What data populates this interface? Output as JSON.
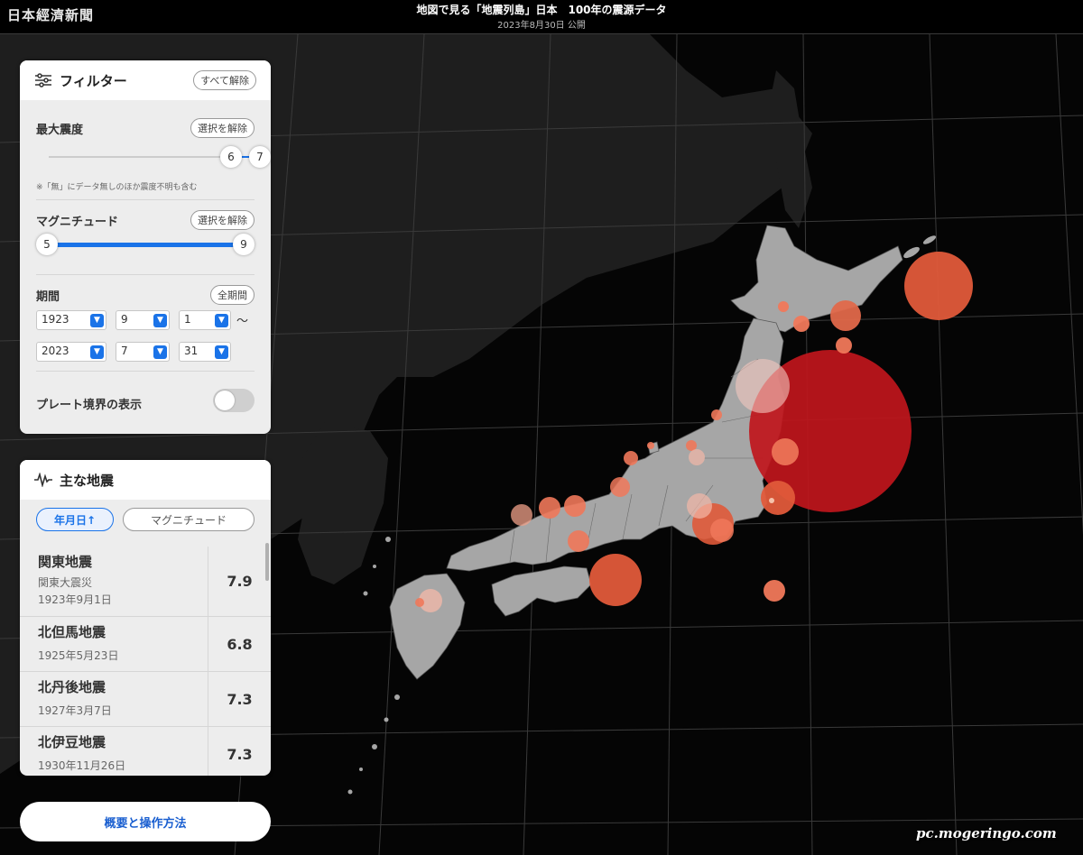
{
  "header": {
    "logo": "日本經濟新聞",
    "headline": "地図で見る「地震列島」日本　100年の震源データ",
    "date": "2023年8月30日 公開"
  },
  "filter": {
    "title": "フィルター",
    "clear_all": "すべて解除",
    "intensity": {
      "label": "最大震度",
      "clear": "選択を解除",
      "low": "6",
      "high": "7",
      "note": "※「無」にデータ無しのほか震度不明も含む"
    },
    "magnitude": {
      "label": "マグニチュード",
      "clear": "選択を解除",
      "low": "5",
      "high": "9"
    },
    "period": {
      "label": "期間",
      "all": "全期間",
      "from": {
        "year": "1923",
        "month": "9",
        "day": "1"
      },
      "tilde": "〜",
      "to": {
        "year": "2023",
        "month": "7",
        "day": "31"
      }
    },
    "plate": {
      "label": "プレート境界の表示",
      "enabled": false
    }
  },
  "quakes": {
    "title": "主な地震",
    "sort_date": "年月日↑",
    "sort_mag": "マグニチュード",
    "items": [
      {
        "name": "関東地震",
        "alias": "関東大震災",
        "date": "1923年9月1日",
        "mag": "7.9"
      },
      {
        "name": "北但馬地震",
        "alias": "",
        "date": "1925年5月23日",
        "mag": "6.8"
      },
      {
        "name": "北丹後地震",
        "alias": "",
        "date": "1927年3月7日",
        "mag": "7.3"
      },
      {
        "name": "北伊豆地震",
        "alias": "",
        "date": "1930年11月26日",
        "mag": "7.3"
      }
    ]
  },
  "overview_button": "概要と操作方法",
  "watermark": "pc.mogeringo.com",
  "colors": {
    "accent": "#1a73e8",
    "quake_large": "#c0161c",
    "quake_medium": "#e05a3a",
    "quake_small": "#f0785a",
    "land": "#a6a6a6"
  }
}
